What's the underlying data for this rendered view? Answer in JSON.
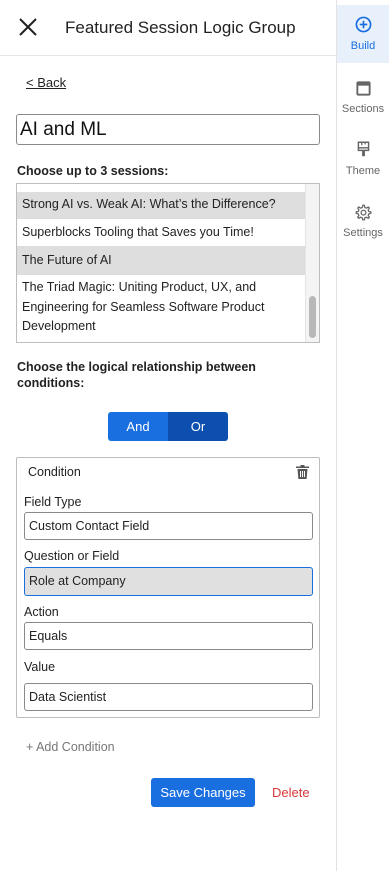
{
  "header": {
    "title": "Featured Session Logic Group",
    "close_icon": "close-icon"
  },
  "back_link": "< Back",
  "group_name": "AI and ML",
  "sessions_label": "Choose up to 3 sessions:",
  "sessions": [
    {
      "title": "Strong AI vs. Weak AI: What’s the Difference?",
      "selected": true
    },
    {
      "title": "Superblocks Tooling that Saves you Time!",
      "selected": false
    },
    {
      "title": "The Future of AI",
      "selected": true
    },
    {
      "title": "The Triad Magic: Uniting Product, UX, and Engineering for Seamless Software Product Development",
      "selected": false
    }
  ],
  "logic_label": "Choose the logical relationship between conditions:",
  "logic_toggle": {
    "and_label": "And",
    "or_label": "Or",
    "selected": "Or"
  },
  "condition": {
    "title": "Condition",
    "delete_icon": "trash-icon",
    "field_type_label": "Field Type",
    "field_type_value": "Custom Contact Field",
    "question_label": "Question or Field",
    "question_value": "Role at Company",
    "action_label": "Action",
    "action_value": "Equals",
    "value_label": "Value",
    "value_value": "Data Scientist"
  },
  "add_condition": "+ Add Condition",
  "save_label": "Save Changes",
  "delete_label": "Delete",
  "rail": [
    {
      "label": "Build",
      "icon": "plus-circle-icon",
      "active": true
    },
    {
      "label": "Sections",
      "icon": "sections-icon",
      "active": false
    },
    {
      "label": "Theme",
      "icon": "paint-brush-icon",
      "active": false
    },
    {
      "label": "Settings",
      "icon": "gear-icon",
      "active": false
    }
  ],
  "colors": {
    "primary": "#1a6fe0",
    "primary_dark": "#0d4fae",
    "danger": "#d93838",
    "selected_row": "#dedede"
  }
}
